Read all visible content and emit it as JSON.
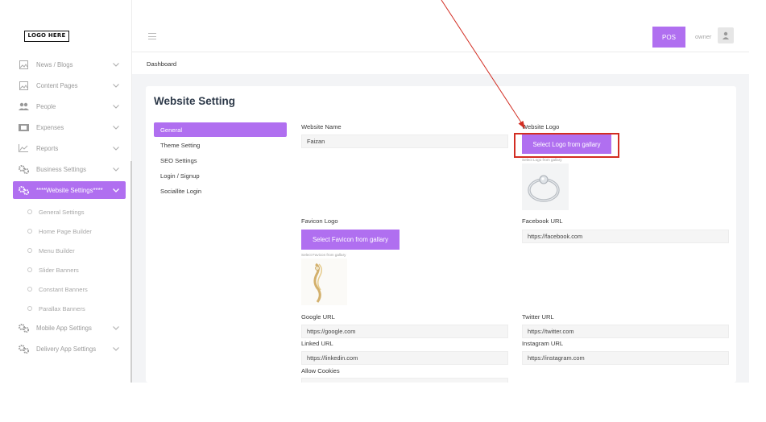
{
  "brand": {
    "logo_text": "LOGO HERE"
  },
  "sidebar": {
    "items": [
      {
        "label": "News / Blogs",
        "icon": "image-icon"
      },
      {
        "label": "Content Pages",
        "icon": "image-icon"
      },
      {
        "label": "People",
        "icon": "people-icon"
      },
      {
        "label": "Expenses",
        "icon": "card-icon"
      },
      {
        "label": "Reports",
        "icon": "chart-icon"
      },
      {
        "label": "Business Settings",
        "icon": "gears-icon"
      },
      {
        "label": "****Website Settings****",
        "icon": "gears-icon",
        "active": true
      },
      {
        "label": "Mobile App Settings",
        "icon": "gears-icon"
      },
      {
        "label": "Delivery App Settings",
        "icon": "gears-icon"
      }
    ],
    "subitems": [
      "General Settings",
      "Home Page Builder",
      "Menu Builder",
      "Slider Banners",
      "Constant Banners",
      "Parallax Banners"
    ]
  },
  "header": {
    "pos_label": "POS",
    "user_name": "owner"
  },
  "breadcrumb": "Dashboard",
  "page": {
    "title": "Website Setting",
    "tabs": [
      "General",
      "Theme Setting",
      "SEO Settings",
      "Login / Signup",
      "Sociallite Login"
    ],
    "active_tab": "General"
  },
  "form": {
    "website_name": {
      "label": "Website Name",
      "value": "Faizan"
    },
    "website_logo": {
      "label": "Website Logo",
      "button": "Select Logo from gallary",
      "caption": "Select Logo from gallary"
    },
    "favicon_logo": {
      "label": "Favicon Logo",
      "button": "Select Favicon from gallary",
      "caption": "Select Favicon from gallary"
    },
    "facebook_url": {
      "label": "Facebook URL",
      "value": "https://facebook.com"
    },
    "google_url": {
      "label": "Google URL",
      "value": "https://google.com"
    },
    "twitter_url": {
      "label": "Twitter URL",
      "value": "https://twitter.com"
    },
    "linked_url": {
      "label": "Linked URL",
      "value": "https://linkedin.com"
    },
    "instagram_url": {
      "label": "Instagram URL",
      "value": "https://instagram.com"
    },
    "allow_cookies": {
      "label": "Allow Cookies",
      "value": ""
    }
  },
  "colors": {
    "accent": "#b06ff0",
    "annotation": "#d22d22",
    "background": "#f3f4f6"
  }
}
